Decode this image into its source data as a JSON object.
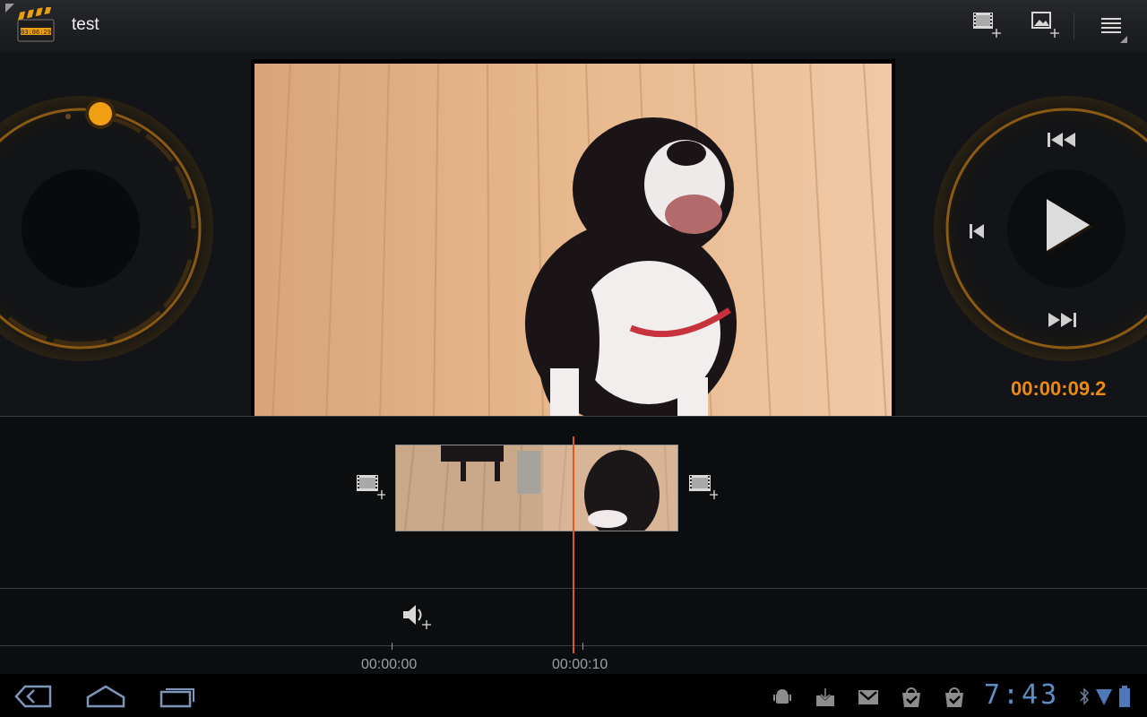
{
  "app": {
    "title": "test",
    "icon": "clapperboard-icon",
    "icon_text": "03:06:29"
  },
  "actionbar": {
    "buttons": [
      {
        "name": "add-video-clip",
        "icon": "film-plus-icon"
      },
      {
        "name": "add-image",
        "icon": "image-plus-icon"
      },
      {
        "name": "menu",
        "icon": "menu-icon"
      }
    ]
  },
  "playback": {
    "current_time": "00:00:09.2",
    "controls": [
      "rewind",
      "previous-frame",
      "play",
      "fast-forward"
    ]
  },
  "timeline": {
    "ruler": [
      {
        "label": "00:00:00"
      },
      {
        "label": "00:00:10"
      }
    ]
  },
  "statusbar": {
    "time": "7:43",
    "notifications": [
      "android-debug-icon",
      "download-icon",
      "gmail-icon",
      "market-icon",
      "market-icon"
    ]
  },
  "colors": {
    "accent": "#e88a14",
    "playhead": "#e05a1e",
    "clock": "#5b8ec7"
  }
}
